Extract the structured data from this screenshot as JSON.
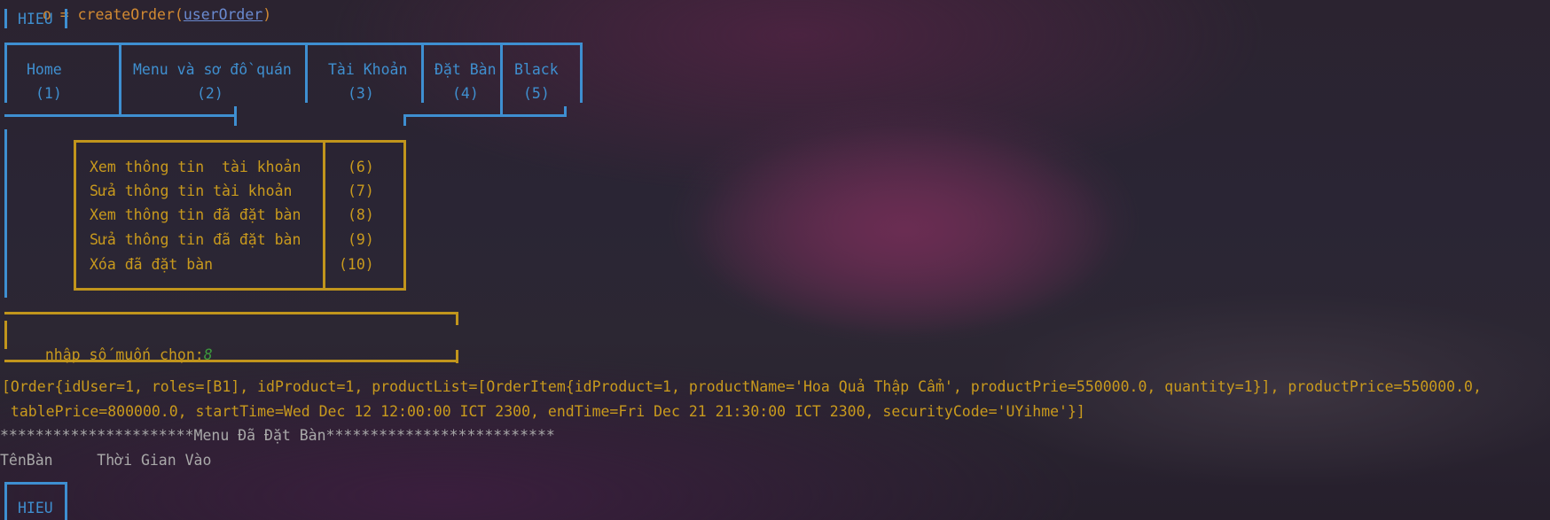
{
  "top_partial_line": "o = createOrder(",
  "top_partial_arg": "userOrder",
  "user_name_top": "HIEU",
  "user_name_bottom": "HIEU",
  "nav": [
    {
      "label": "Home",
      "key": "(1)"
    },
    {
      "label": "Menu và sơ đồ quán",
      "key": "(2)"
    },
    {
      "label": "Tài Khoản",
      "key": "(3)"
    },
    {
      "label": "Đặt Bàn",
      "key": "(4)"
    },
    {
      "label": "Black",
      "key": "(5)"
    }
  ],
  "submenu": [
    {
      "label": "Xem thông tin  tài khoản",
      "key": "(6)"
    },
    {
      "label": "Sửa thông tin tài khoản",
      "key": "(7)"
    },
    {
      "label": "Xem thông tin đã đặt bàn",
      "key": "(8)"
    },
    {
      "label": "Sửa thông tin đã đặt bàn",
      "key": "(9)"
    },
    {
      "label": "Xóa đã đặt bàn",
      "key": "(10)"
    }
  ],
  "prompt": {
    "label": "nhập số muốn chọn:",
    "value": "8"
  },
  "output": {
    "order_line_1": "[Order{idUser=1, roles=[B1], idProduct=1, productList=[OrderItem{idProduct=1, productName='Hoa Quả Thập Cẩm', productPrie=550000.0, quantity=1}], productPrice=550000.0,",
    "order_line_2": " tablePrice=800000.0, startTime=Wed Dec 12 12:00:00 ICT 2300, endTime=Fri Dec 21 21:30:00 ICT 2300, securityCode='UYihme'}]",
    "menu_header": "**********************Menu Đã Đặt Bàn**************************",
    "columns": "TênBàn     Thời Gian Vào"
  },
  "colors": {
    "blue": "#3f8fcf",
    "gold": "#c99a1d",
    "gray": "#a9a9a9",
    "green": "#3d9a3d"
  }
}
